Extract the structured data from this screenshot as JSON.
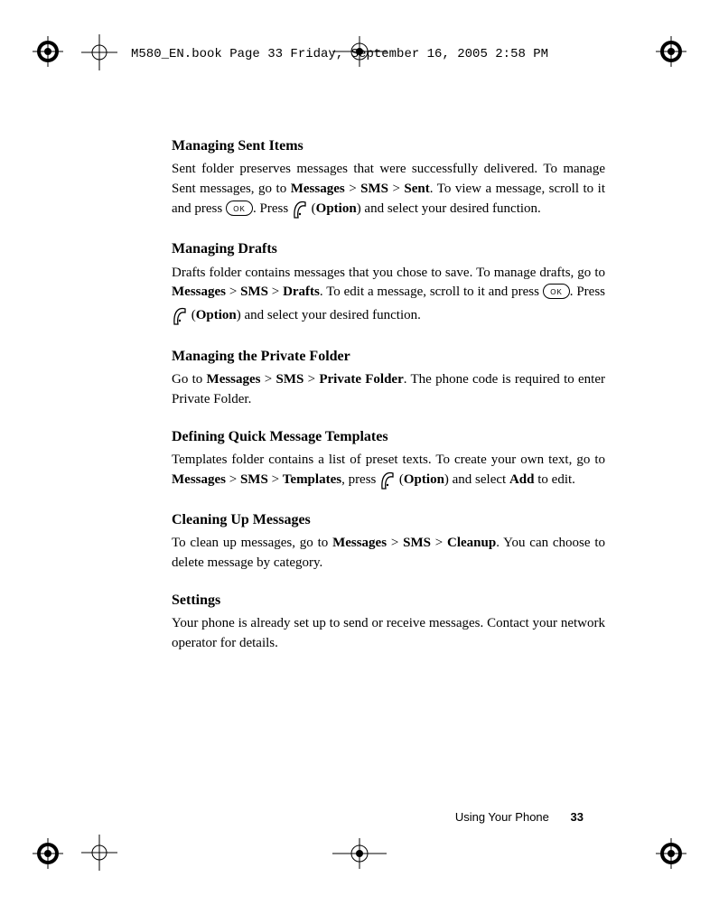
{
  "header": {
    "filename_line": "M580_EN.book  Page 33  Friday, September 16, 2005  2:58 PM"
  },
  "sections": {
    "sent": {
      "title": "Managing Sent Items",
      "p1a": "Sent folder preserves messages that were successfully delivered. To manage Sent messages, go to ",
      "messages": "Messages",
      "gt1": " > ",
      "sms": "SMS",
      "gt2": "  > ",
      "sent": "Sent",
      "p1b": ". To view a message, scroll to it and press ",
      "p1c": ". Press ",
      "option_open": " (",
      "option": "Option",
      "option_close": ") and select your desired function."
    },
    "drafts": {
      "title": "Managing Drafts",
      "p1a": "Drafts folder contains messages that you chose to save. To manage drafts, go to ",
      "messages": "Messages",
      "gt1": " > ",
      "sms": "SMS",
      "gt2": "  > ",
      "drafts": "Drafts",
      "p1b": ". To edit a message, scroll to it and  press  ",
      "p1c": ".  Press  ",
      "option_open": "  (",
      "option": "Option",
      "option_close": ")  and  select  your  desired function."
    },
    "private": {
      "title": "Managing the Private Folder",
      "p1a": "Go to ",
      "messages": "Messages",
      "gt1": " > ",
      "sms": "SMS",
      "gt2": " > ",
      "pf": "Private Folder",
      "p1b": ". The phone code is required to enter Private Folder."
    },
    "templates": {
      "title": "Defining Quick Message Templates",
      "p1a": "Templates folder contains a list of preset texts. To create your own text, go to ",
      "messages": "Messages",
      "gt1": " > ",
      "sms": "SMS",
      "gt2": "  > ",
      "templates": "Templates",
      "p1b": ", press ",
      "option_open": " (",
      "option": "Option",
      "option_close": ") and select ",
      "add": "Add",
      "p1c": " to edit."
    },
    "cleanup": {
      "title": "Cleaning Up Messages",
      "p1a": "To clean up messages, go to ",
      "messages": "Messages",
      "gt1": " > ",
      "sms": "SMS",
      "gt2": "  > ",
      "cleanup": "Cleanup",
      "p1b": ". You can choose to delete message by category."
    },
    "settings": {
      "title": "Settings",
      "p1": "Your phone is already set up to send or receive messages. Contact your network operator for details."
    }
  },
  "footer": {
    "label": "Using Your Phone",
    "page": "33"
  },
  "icons": {
    "ok": "ok-button-icon",
    "softkey": "softkey-icon",
    "registration": "registration-mark-icon",
    "cropmark": "crop-mark-icon",
    "center": "center-mark-icon"
  }
}
